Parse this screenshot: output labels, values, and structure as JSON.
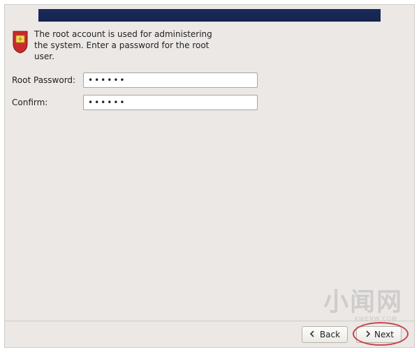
{
  "intro": {
    "text": "The root account is used for administering the system.  Enter a password for the root user."
  },
  "form": {
    "root_password": {
      "label": "Root Password:",
      "value": "••••••"
    },
    "confirm": {
      "label": "Confirm:",
      "value": "••••••"
    }
  },
  "footer": {
    "back_label": "Back",
    "next_label": "Next"
  },
  "watermark": {
    "main": "小闻网",
    "sub": "XWENW.COM"
  },
  "icon_name": "shield-icon"
}
